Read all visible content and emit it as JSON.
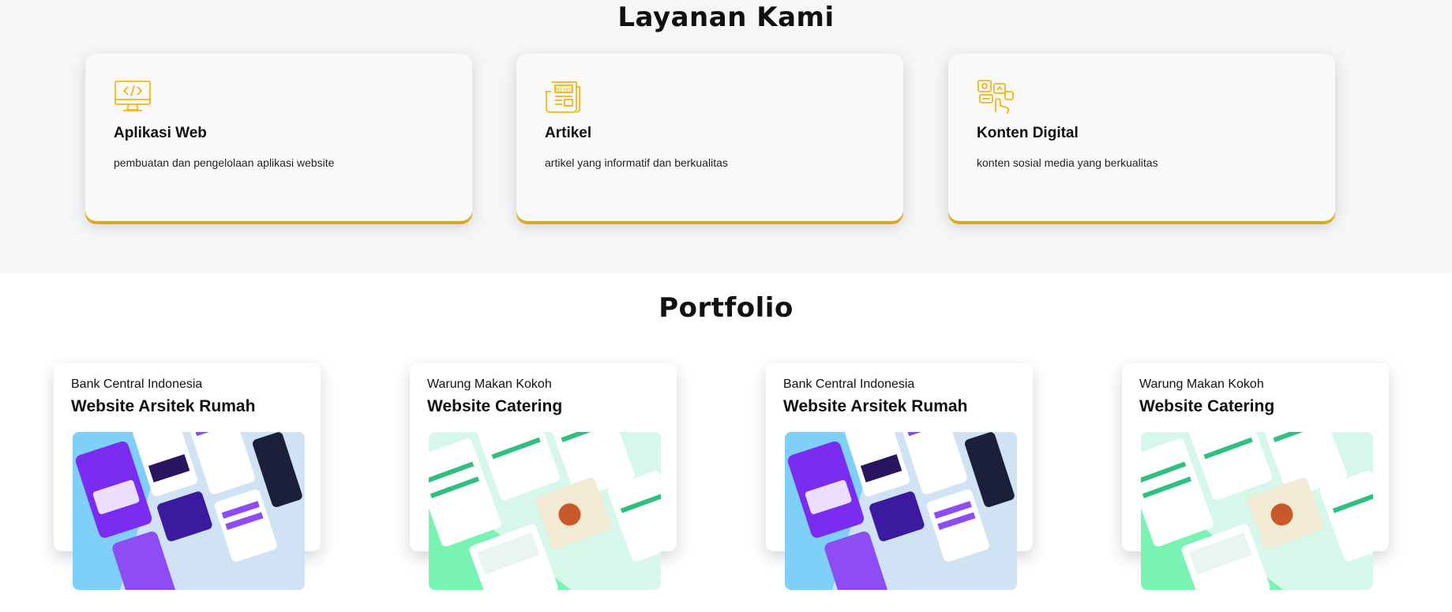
{
  "services": {
    "title": "Layanan Kami",
    "accent_color": "#f2b614",
    "items": [
      {
        "icon": "monitor-code-icon",
        "title": "Aplikasi Web",
        "description": "pembuatan dan pengelolaan aplikasi website"
      },
      {
        "icon": "newspaper-icon",
        "title": "Artikel",
        "description": "artikel yang informatif dan berkualitas"
      },
      {
        "icon": "social-content-icon",
        "title": "Konten Digital",
        "description": "konten sosial media yang berkualitas"
      }
    ]
  },
  "portfolio": {
    "title": "Portfolio",
    "items": [
      {
        "client": "Bank Central Indonesia",
        "title": "Website Arsitek Rumah",
        "thumb": "purple-app-mockup"
      },
      {
        "client": "Warung Makan Kokoh",
        "title": "Website Catering",
        "thumb": "green-catering-mockup"
      },
      {
        "client": "Bank Central Indonesia",
        "title": "Website Arsitek Rumah",
        "thumb": "purple-app-mockup"
      },
      {
        "client": "Warung Makan Kokoh",
        "title": "Website Catering",
        "thumb": "green-catering-mockup"
      }
    ]
  }
}
